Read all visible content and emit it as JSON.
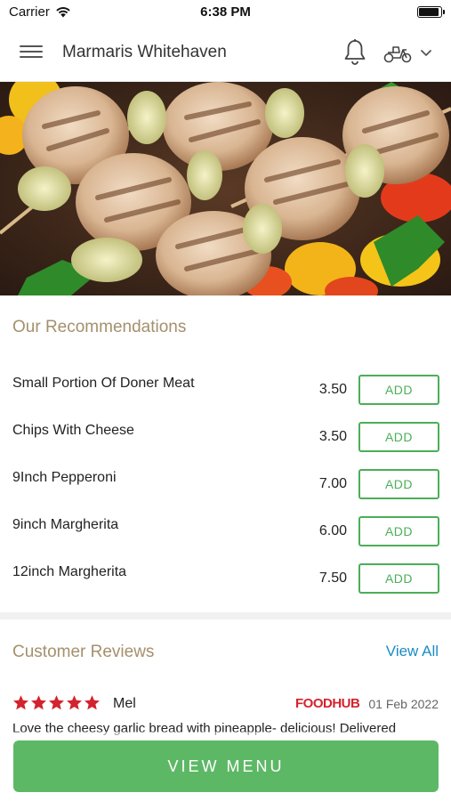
{
  "status_bar": {
    "carrier": "Carrier",
    "time": "6:38 PM",
    "battery_level": 0.95
  },
  "header": {
    "title": "Marmaris Whitehaven",
    "icons": [
      "menu-icon",
      "bell-icon",
      "scooter-icon",
      "chevron-down-icon"
    ]
  },
  "hero": {
    "description_icon": "food-photo"
  },
  "recommendations": {
    "title": "Our Recommendations",
    "items": [
      {
        "name": "Small Portion Of Doner Meat",
        "price": "3.50",
        "action": "ADD"
      },
      {
        "name": "Chips With Cheese",
        "price": "3.50",
        "action": "ADD"
      },
      {
        "name": "9Inch Pepperoni",
        "price": "7.00",
        "action": "ADD"
      },
      {
        "name": "9inch Margherita",
        "price": "6.00",
        "action": "ADD"
      },
      {
        "name": "12inch Margherita",
        "price": "7.50",
        "action": "ADD"
      }
    ]
  },
  "reviews": {
    "title": "Customer Reviews",
    "view_all": "View All",
    "items": [
      {
        "rating": 5,
        "author": "Mel",
        "source": "FOODHUB",
        "date": "01 Feb 2022",
        "text": "Love the cheesy garlic bread with pineapple- delicious! Delivered"
      }
    ]
  },
  "footer": {
    "view_menu": "VIEW MENU"
  },
  "colors": {
    "accent_green": "#5db866",
    "add_green": "#4cae58",
    "section_title": "#a4906c",
    "link_blue": "#1c8cc4",
    "star_red": "#d3232e"
  }
}
